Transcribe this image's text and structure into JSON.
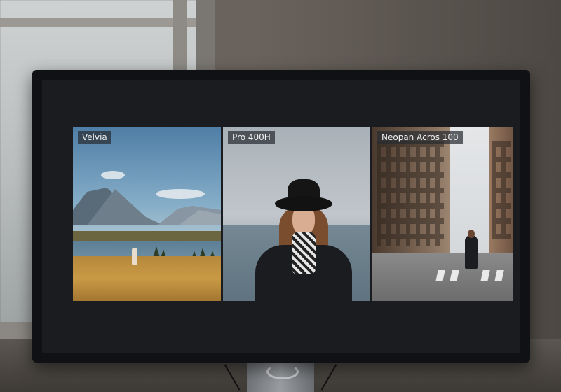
{
  "screen": {
    "panels": [
      {
        "label": "Velvia"
      },
      {
        "label": "Pro 400H"
      },
      {
        "label": "Neopan Acros 100"
      }
    ]
  }
}
